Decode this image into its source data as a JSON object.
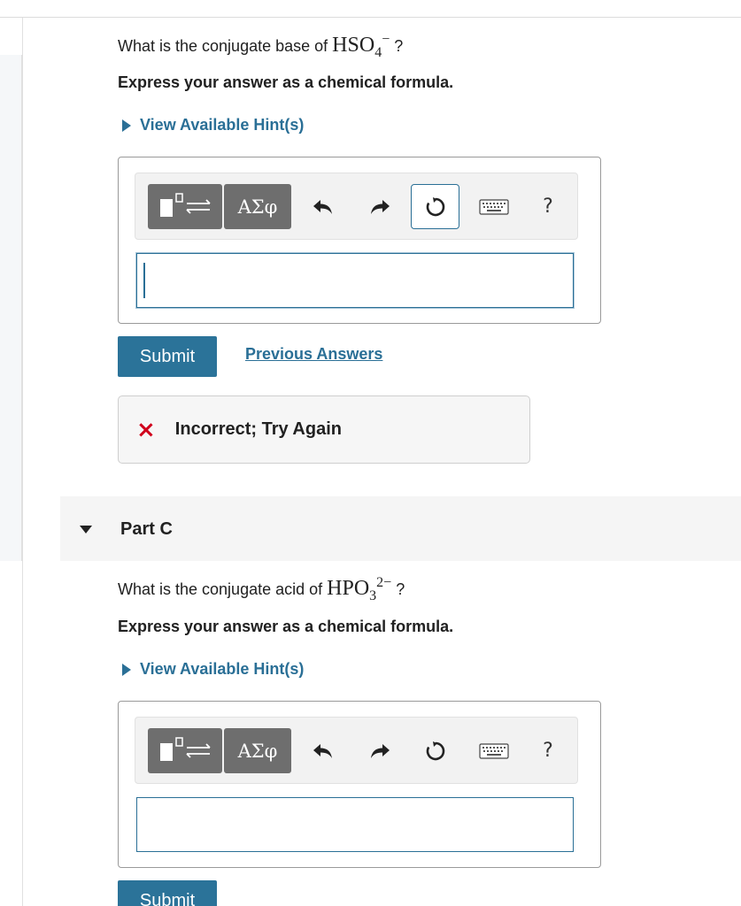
{
  "partB": {
    "question_prefix": "What is the conjugate base of",
    "formula_main": "HSO",
    "formula_sub": "4",
    "formula_sup": "−",
    "question_suffix": "?",
    "instruction": "Express your answer as a chemical formula.",
    "hint_label": "View Available Hint(s)",
    "greek_label": "ΑΣφ",
    "help_label": "?",
    "answer_value": "",
    "submit_label": "Submit",
    "previous_answers_label": "Previous Answers",
    "feedback_icon": "×",
    "feedback_text": "Incorrect; Try Again"
  },
  "partC": {
    "title": "Part C",
    "question_prefix": "What is the conjugate acid of",
    "formula_main": "HPO",
    "formula_sub": "3",
    "formula_sup": "2−",
    "question_suffix": "?",
    "instruction": "Express your answer as a chemical formula.",
    "hint_label": "View Available Hint(s)",
    "greek_label": "ΑΣφ",
    "help_label": "?",
    "answer_value": "",
    "submit_label": "Submit"
  },
  "colors": {
    "accent": "#2a6f96",
    "submit_bg": "#2b7399",
    "error": "#d0021b",
    "tool_btn_bg": "#6e6e6e"
  },
  "icons": {
    "template": "templates-icon",
    "greek": "greek-symbols-icon",
    "undo": "undo-icon",
    "redo": "redo-icon",
    "reset": "reset-icon",
    "keyboard": "keyboard-shortcuts-icon",
    "help": "help-icon",
    "hint": "caret-right-icon",
    "collapse": "caret-down-icon",
    "error": "x-mark-icon"
  }
}
